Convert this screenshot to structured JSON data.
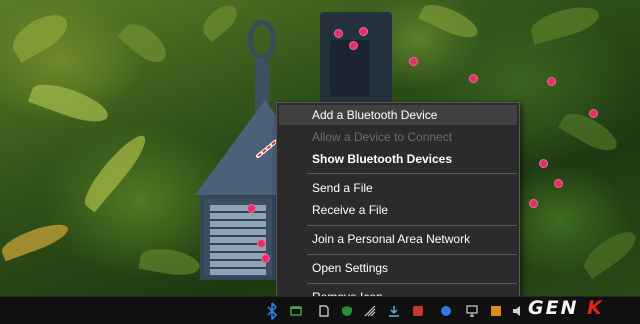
{
  "context_menu": {
    "items": [
      {
        "label": "Add a Bluetooth Device",
        "state": "hover"
      },
      {
        "label": "Allow a Device to Connect",
        "state": "disabled"
      },
      {
        "label": "Show Bluetooth Devices",
        "state": "default-bold"
      },
      {
        "label": "Send a File",
        "state": "normal"
      },
      {
        "label": "Receive a File",
        "state": "normal"
      },
      {
        "label": "Join a Personal Area Network",
        "state": "normal"
      },
      {
        "label": "Open Settings",
        "state": "normal"
      },
      {
        "label": "Remove Icon",
        "state": "normal"
      }
    ]
  },
  "taskbar": {
    "tray_icons": [
      "bluetooth-icon",
      "app-icon",
      "app-icon",
      "app-icon",
      "app-icon",
      "app-icon",
      "app-icon",
      "app-icon",
      "network-icon",
      "chevron-up-icon",
      "volume-icon"
    ]
  },
  "watermark": {
    "text": "GENK"
  },
  "colors": {
    "menu_bg": "#2b2b2b",
    "menu_hover": "#414141",
    "disabled_text": "#6d6d6d",
    "arrow": "#d9302a",
    "bluetooth": "#2f7fe0"
  }
}
